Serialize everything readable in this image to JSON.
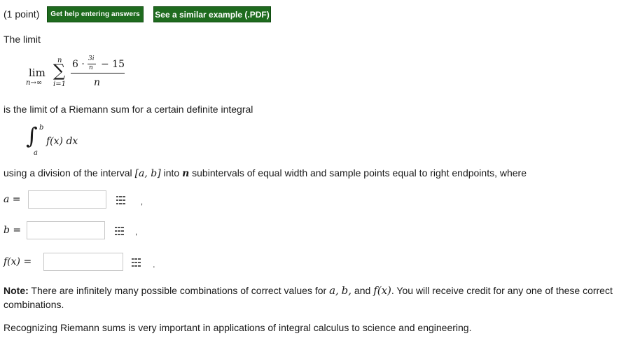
{
  "header": {
    "points": "(1 point)",
    "help_button": "Get help entering answers",
    "example_button": "See a similar example (.PDF)"
  },
  "problem": {
    "intro": "The limit",
    "limit": {
      "lim": "lim",
      "under": "n→∞",
      "sum_upper": "n",
      "sum_lower": "i=1",
      "numerator_coef": "6 ·",
      "inner_num": "3i",
      "inner_den": "n",
      "minus_const": "− 15",
      "denominator": "n"
    },
    "sentence1": "is the limit of a Riemann sum for a certain definite integral",
    "integral": {
      "upper": "b",
      "lower": "a",
      "integrand": "f(x) dx"
    },
    "sentence2_a": "using a division of the interval ",
    "sentence2_interval": "[a, b]",
    "sentence2_b": " into ",
    "sentence2_n": "n",
    "sentence2_c": " subintervals of equal width and sample points equal to right endpoints, where"
  },
  "answers": {
    "a_label": "a =",
    "a_value": "",
    "a_punct": ",",
    "b_label": "b =",
    "b_value": "",
    "b_punct": ",",
    "f_label": "f(x) =",
    "f_value": "",
    "f_punct": "."
  },
  "note": {
    "bold": "Note:",
    "text1": " There are infinitely many possible combinations of correct values for ",
    "var_a": "a,",
    "var_b": "b,",
    "and": " and ",
    "var_f": "f(x)",
    "text2": ". You will receive credit for any one of these correct",
    "text3": "combinations."
  },
  "footer": {
    "text": "Recognizing Riemann sums is very important in applications of integral calculus to science and engineering."
  },
  "colors": {
    "button_bg": "#1e6b1e",
    "field_border": "#c8c8c8"
  },
  "icons": [
    "equation-editor-icon"
  ]
}
